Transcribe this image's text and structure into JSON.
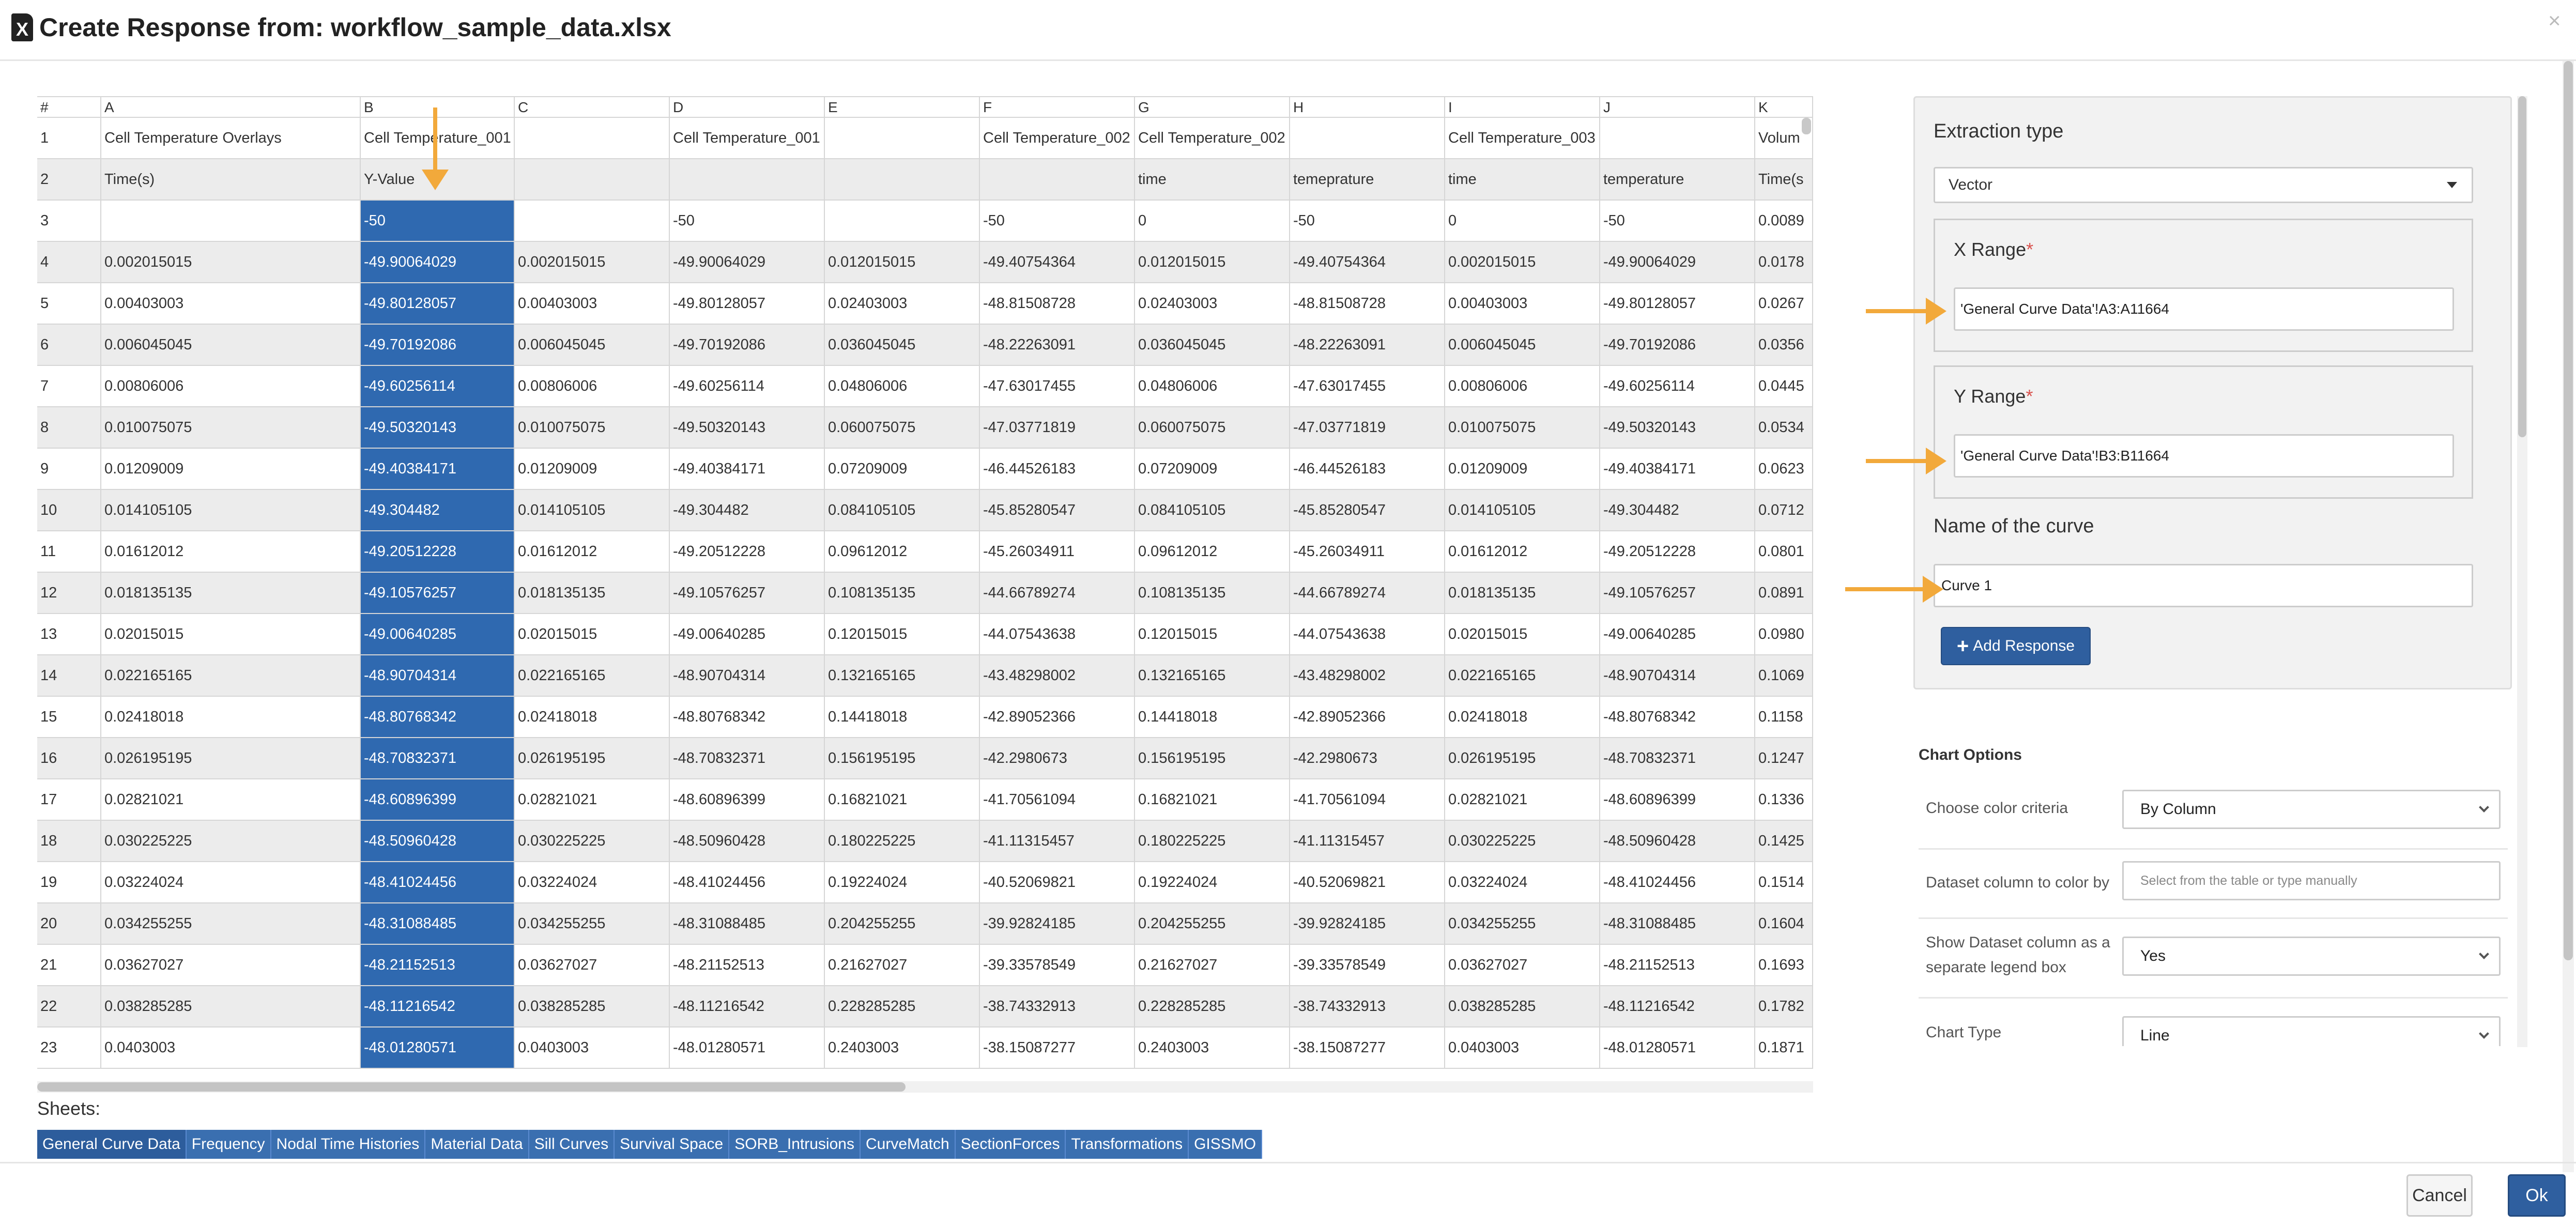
{
  "dialog": {
    "icon_letter": "X",
    "title": "Create Response from: workflow_sample_data.xlsx",
    "close_symbol": "×"
  },
  "spreadsheet": {
    "columns": [
      "#",
      "A",
      "B",
      "C",
      "D",
      "E",
      "F",
      "G",
      "H",
      "I",
      "J",
      "K"
    ],
    "selected_column": "B",
    "rows": [
      [
        "1",
        "Cell Temperature Overlays",
        "Cell Temperature_001",
        "",
        "Cell Temperature_001",
        "",
        "Cell Temperature_002",
        "Cell Temperature_002",
        "",
        "Cell Temperature_003",
        "",
        "Volum"
      ],
      [
        "2",
        "Time(s)",
        "Y-Value",
        "",
        "",
        "",
        "",
        "time",
        "temeprature",
        "time",
        "temperature",
        "Time(s"
      ],
      [
        "3",
        "",
        "-50",
        "",
        "-50",
        "",
        "-50",
        "0",
        "-50",
        "0",
        "-50",
        "0.0089"
      ],
      [
        "4",
        "0.002015015",
        "-49.90064029",
        "0.002015015",
        "-49.90064029",
        "0.012015015",
        "-49.40754364",
        "0.012015015",
        "-49.40754364",
        "0.002015015",
        "-49.90064029",
        "0.0178"
      ],
      [
        "5",
        "0.00403003",
        "-49.80128057",
        "0.00403003",
        "-49.80128057",
        "0.02403003",
        "-48.81508728",
        "0.02403003",
        "-48.81508728",
        "0.00403003",
        "-49.80128057",
        "0.0267"
      ],
      [
        "6",
        "0.006045045",
        "-49.70192086",
        "0.006045045",
        "-49.70192086",
        "0.036045045",
        "-48.22263091",
        "0.036045045",
        "-48.22263091",
        "0.006045045",
        "-49.70192086",
        "0.0356"
      ],
      [
        "7",
        "0.00806006",
        "-49.60256114",
        "0.00806006",
        "-49.60256114",
        "0.04806006",
        "-47.63017455",
        "0.04806006",
        "-47.63017455",
        "0.00806006",
        "-49.60256114",
        "0.0445"
      ],
      [
        "8",
        "0.010075075",
        "-49.50320143",
        "0.010075075",
        "-49.50320143",
        "0.060075075",
        "-47.03771819",
        "0.060075075",
        "-47.03771819",
        "0.010075075",
        "-49.50320143",
        "0.0534"
      ],
      [
        "9",
        "0.01209009",
        "-49.40384171",
        "0.01209009",
        "-49.40384171",
        "0.07209009",
        "-46.44526183",
        "0.07209009",
        "-46.44526183",
        "0.01209009",
        "-49.40384171",
        "0.0623"
      ],
      [
        "10",
        "0.014105105",
        "-49.304482",
        "0.014105105",
        "-49.304482",
        "0.084105105",
        "-45.85280547",
        "0.084105105",
        "-45.85280547",
        "0.014105105",
        "-49.304482",
        "0.0712"
      ],
      [
        "11",
        "0.01612012",
        "-49.20512228",
        "0.01612012",
        "-49.20512228",
        "0.09612012",
        "-45.26034911",
        "0.09612012",
        "-45.26034911",
        "0.01612012",
        "-49.20512228",
        "0.0801"
      ],
      [
        "12",
        "0.018135135",
        "-49.10576257",
        "0.018135135",
        "-49.10576257",
        "0.108135135",
        "-44.66789274",
        "0.108135135",
        "-44.66789274",
        "0.018135135",
        "-49.10576257",
        "0.0891"
      ],
      [
        "13",
        "0.02015015",
        "-49.00640285",
        "0.02015015",
        "-49.00640285",
        "0.12015015",
        "-44.07543638",
        "0.12015015",
        "-44.07543638",
        "0.02015015",
        "-49.00640285",
        "0.0980"
      ],
      [
        "14",
        "0.022165165",
        "-48.90704314",
        "0.022165165",
        "-48.90704314",
        "0.132165165",
        "-43.48298002",
        "0.132165165",
        "-43.48298002",
        "0.022165165",
        "-48.90704314",
        "0.1069"
      ],
      [
        "15",
        "0.02418018",
        "-48.80768342",
        "0.02418018",
        "-48.80768342",
        "0.14418018",
        "-42.89052366",
        "0.14418018",
        "-42.89052366",
        "0.02418018",
        "-48.80768342",
        "0.1158"
      ],
      [
        "16",
        "0.026195195",
        "-48.70832371",
        "0.026195195",
        "-48.70832371",
        "0.156195195",
        "-42.2980673",
        "0.156195195",
        "-42.2980673",
        "0.026195195",
        "-48.70832371",
        "0.1247"
      ],
      [
        "17",
        "0.02821021",
        "-48.60896399",
        "0.02821021",
        "-48.60896399",
        "0.16821021",
        "-41.70561094",
        "0.16821021",
        "-41.70561094",
        "0.02821021",
        "-48.60896399",
        "0.1336"
      ],
      [
        "18",
        "0.030225225",
        "-48.50960428",
        "0.030225225",
        "-48.50960428",
        "0.180225225",
        "-41.11315457",
        "0.180225225",
        "-41.11315457",
        "0.030225225",
        "-48.50960428",
        "0.1425"
      ],
      [
        "19",
        "0.03224024",
        "-48.41024456",
        "0.03224024",
        "-48.41024456",
        "0.19224024",
        "-40.52069821",
        "0.19224024",
        "-40.52069821",
        "0.03224024",
        "-48.41024456",
        "0.1514"
      ],
      [
        "20",
        "0.034255255",
        "-48.31088485",
        "0.034255255",
        "-48.31088485",
        "0.204255255",
        "-39.92824185",
        "0.204255255",
        "-39.92824185",
        "0.034255255",
        "-48.31088485",
        "0.1604"
      ],
      [
        "21",
        "0.03627027",
        "-48.21152513",
        "0.03627027",
        "-48.21152513",
        "0.21627027",
        "-39.33578549",
        "0.21627027",
        "-39.33578549",
        "0.03627027",
        "-48.21152513",
        "0.1693"
      ],
      [
        "22",
        "0.038285285",
        "-48.11216542",
        "0.038285285",
        "-48.11216542",
        "0.228285285",
        "-38.74332913",
        "0.228285285",
        "-38.74332913",
        "0.038285285",
        "-48.11216542",
        "0.1782"
      ],
      [
        "23",
        "0.0403003",
        "-48.01280571",
        "0.0403003",
        "-48.01280571",
        "0.2403003",
        "-38.15087277",
        "0.2403003",
        "-38.15087277",
        "0.0403003",
        "-48.01280571",
        "0.1871"
      ]
    ]
  },
  "sheets": {
    "label": "Sheets:",
    "tabs": [
      "General Curve Data",
      "Frequency",
      "Nodal Time Histories",
      "Material Data",
      "Sill Curves",
      "Survival Space",
      "SORB_Intrusions",
      "CurveMatch",
      "SectionForces",
      "Transformations",
      "GISSMO"
    ],
    "active": "General Curve Data"
  },
  "extraction": {
    "type_label": "Extraction type",
    "type_value": "Vector",
    "x_range_label": "X Range",
    "x_range_value": "'General Curve Data'!A3:A11664",
    "y_range_label": "Y Range",
    "y_range_value": "'General Curve Data'!B3:B11664",
    "required_mark": "*",
    "curve_name_label": "Name of the curve",
    "curve_name_value": "Curve 1",
    "add_response_label": "Add Response",
    "add_icon": "plus-icon"
  },
  "chart_options": {
    "title": "Chart Options",
    "color_criteria_label": "Choose color criteria",
    "color_criteria_value": "By Column",
    "dataset_column_label": "Dataset column to color by",
    "dataset_column_placeholder": "Select from the table or type manually",
    "legend_label": "Show Dataset column as a separate legend box",
    "legend_value": "Yes",
    "chart_type_label": "Chart Type",
    "chart_type_value": "Line"
  },
  "footer": {
    "cancel_label": "Cancel",
    "ok_label": "Ok"
  },
  "colors": {
    "selected_column": "#2f69b0",
    "primary_button": "#2f5f9f",
    "annotation_arrow": "#f2a93b",
    "required_asterisk": "#d9534f"
  }
}
